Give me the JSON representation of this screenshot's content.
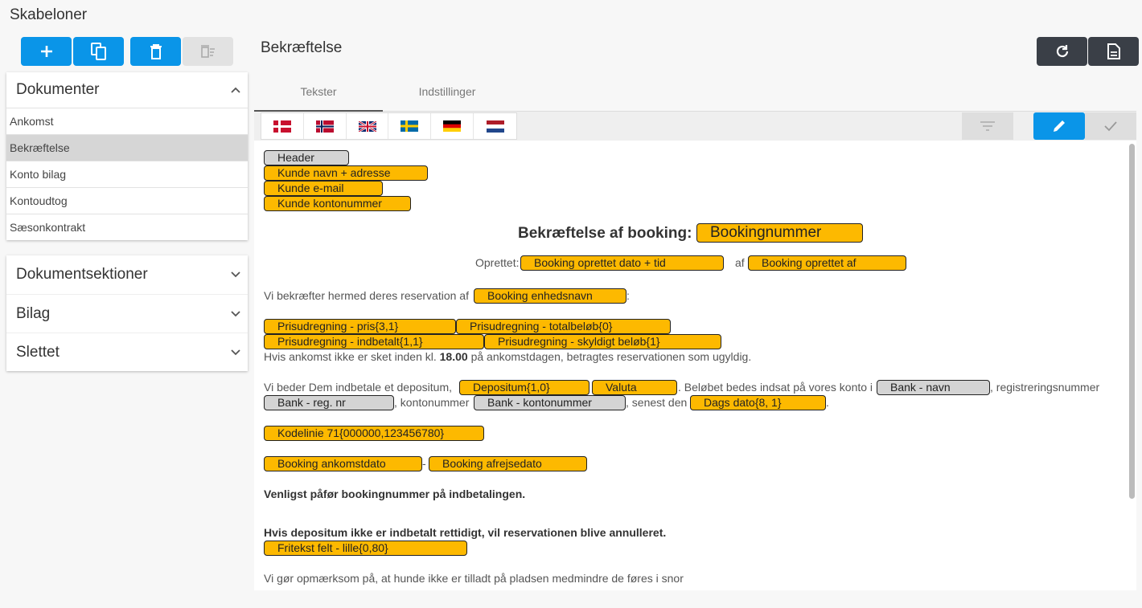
{
  "app": {
    "title": "Skabeloner"
  },
  "sidebar": {
    "documents_header": "Dokumenter",
    "documents": [
      "Ankomst",
      "Bekræftelse",
      "Konto bilag",
      "Kontoudtog",
      "Sæsonkontrakt"
    ],
    "active_document": "Bekræftelse",
    "sections": [
      "Dokumentsektioner",
      "Bilag",
      "Slettet"
    ]
  },
  "main": {
    "title": "Bekræftelse",
    "tabs": [
      "Tekster",
      "Indstillinger"
    ],
    "active_tab": "Tekster",
    "languages": [
      "Danish",
      "Norwegian",
      "English",
      "Swedish",
      "German",
      "Dutch"
    ]
  },
  "editor": {
    "header_block": [
      "Header",
      "Kunde navn + adresse",
      "Kunde e-mail",
      "Kunde kontonummer"
    ],
    "heading": "Bekræftelse af booking:",
    "heading_field": "Bookingnummer",
    "created_label": "Oprettet:",
    "created_field": "Booking oprettet dato + tid",
    "by_label": "af",
    "by_field": "Booking oprettet af",
    "reserve_text": "Vi bekræfter hermed deres reservation af",
    "reserve_field": "Booking enhedsnavn",
    "reserve_end": ":",
    "price_fields": [
      "Prisudregning - pris{3,1}",
      "Prisudregning - totalbeløb{0}",
      "Prisudregning - indbetalt{1,1}",
      "Prisudregning - skyldigt beløb{1}"
    ],
    "arrival_pre": "Hvis ankomst ikke er sket inden kl.",
    "arrival_time": "18.00",
    "arrival_post": "på ankomstdagen, betragtes reservationen som ugyldig.",
    "deposit_pre": "Vi beder Dem indbetale et depositum,",
    "deposit_field": "Depositum{1,0}",
    "currency_field": "Valuta",
    "deposit_mid": ". Beløbet bedes indsat på vores konto i",
    "bank_name_field": "Bank - navn",
    "reg_label": ", registreringsnummer",
    "bank_reg_field": "Bank - reg. nr",
    "account_label": ", kontonummer",
    "bank_account_field": "Bank - kontonummer",
    "latest_label": ", senest den",
    "date_field": "Dags dato{8, 1}",
    "period": ".",
    "code_field": "Kodelinie 71{000000,123456780}",
    "arrival_field": "Booking ankomstdato",
    "dash": "-",
    "departure_field": "Booking afrejsedato",
    "note1": "Venligst påfør bookingnummer på indbetalingen.",
    "note2": "Hvis depositum ikke er indbetalt rettidigt, vil reservationen blive annulleret.",
    "freetext_field": "Fritekst felt - lille{0,80}",
    "dogs_text": "Vi gør opmærksom på, at hunde ikke er tilladt på pladsen medmindre de føres i snor"
  },
  "colors": {
    "accent": "#0a95e8",
    "dark_button": "#3a3f47",
    "field_yellow": "#fdb900",
    "field_gray": "#d4d4d4"
  }
}
